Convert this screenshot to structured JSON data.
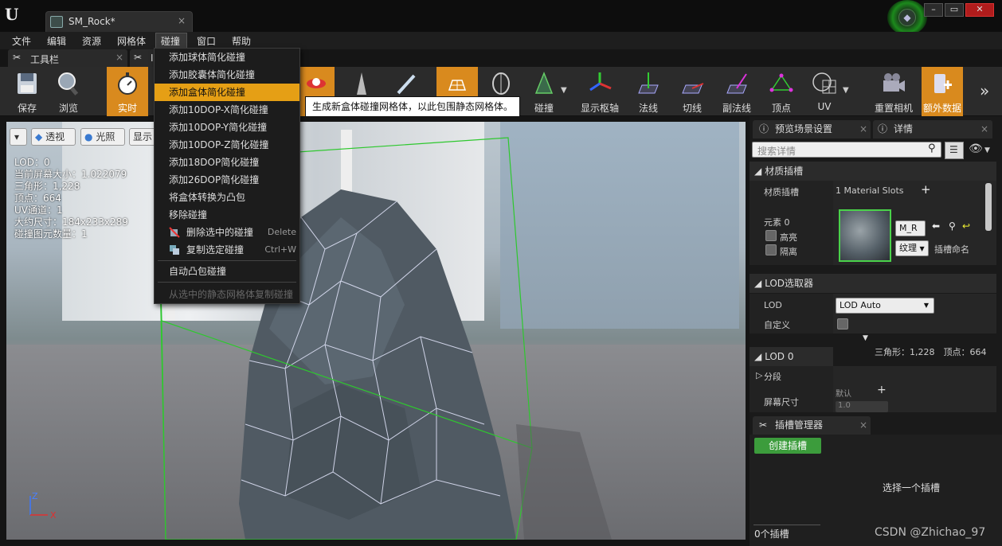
{
  "app": {
    "logo": "U",
    "doc_tab": "SM_Rock*",
    "close_glyph": "×"
  },
  "menus": [
    "文件",
    "编辑",
    "资源",
    "网格体",
    "碰撞",
    "窗口",
    "帮助"
  ],
  "panel_tabs": {
    "toolbar": "工具栏",
    "second": "I"
  },
  "toolbar": {
    "save": "保存",
    "browse": "浏览",
    "realtime": "实时",
    "collision": "碰撞",
    "show_pivot": "显示枢轴",
    "normals": "法线",
    "tangents": "切线",
    "binormals": "副法线",
    "vertices": "顶点",
    "uv": "UV",
    "reset_camera": "重置相机",
    "extra_data": "额外数据"
  },
  "viewport": {
    "perspective": "透视",
    "lit": "光照",
    "show": "显示",
    "stats": [
      "LOD：0",
      "当前屏幕大小：1.022079",
      "三角形：1,228",
      "顶点：664",
      "UV通道：1",
      "大约尺寸：184x233x289",
      "碰撞图元数量：1"
    ],
    "axis_z": "Z",
    "axis_x": "X"
  },
  "collision_menu": {
    "items": [
      {
        "label": "添加球体简化碰撞",
        "shortcut": ""
      },
      {
        "label": "添加胶囊体简化碰撞",
        "shortcut": ""
      },
      {
        "label": "添加盒体简化碰撞",
        "shortcut": ""
      },
      {
        "label": "添加10DOP-X简化碰撞",
        "shortcut": ""
      },
      {
        "label": "添加10DOP-Y简化碰撞",
        "shortcut": ""
      },
      {
        "label": "添加10DOP-Z简化碰撞",
        "shortcut": ""
      },
      {
        "label": "添加18DOP简化碰撞",
        "shortcut": ""
      },
      {
        "label": "添加26DOP简化碰撞",
        "shortcut": ""
      },
      {
        "label": "将盒体转换为凸包",
        "shortcut": ""
      },
      {
        "label": "移除碰撞",
        "shortcut": ""
      },
      {
        "label": "删除选中的碰撞",
        "shortcut": "Delete"
      },
      {
        "label": "复制选定碰撞",
        "shortcut": "Ctrl+W"
      },
      {
        "label": "自动凸包碰撞",
        "shortcut": ""
      },
      {
        "label": "从选中的静态网格体复制碰撞",
        "shortcut": ""
      }
    ],
    "highlight_index": 2,
    "tooltip": "生成新盒体碰撞网格体，以此包围静态网格体。"
  },
  "right_panel": {
    "tab_preview": "预览场景设置",
    "tab_details": "详情",
    "search_placeholder": "搜索详情",
    "material_slots_header": "材质插槽",
    "material_slots_label": "材质插槽",
    "material_slots_value": "1 Material Slots",
    "element_label": "元素 0",
    "highlight": "高亮",
    "isolate": "隔离",
    "material_name": "M_R",
    "texture": "纹理",
    "slot_name": "插槽命名",
    "lod_picker_header": "LOD选取器",
    "lod_label": "LOD",
    "lod_value": "LOD Auto",
    "custom_label": "自定义",
    "lod_stats": "三角形：1,228　顶点：664",
    "lod0_header": "LOD 0",
    "sections": "分段",
    "screen_size": "屏幕尺寸",
    "default_label": "默认",
    "screen_size_value": "1.0"
  },
  "socket_manager": {
    "tab": "插槽管理器",
    "create_button": "创建插槽",
    "select_prompt": "选择一个插槽",
    "count": "0个插槽"
  },
  "watermark": "CSDN @Zhichao_97",
  "colors": {
    "accent_orange": "#d98a1e",
    "menu_highlight": "#e59f15",
    "create_green": "#3c9c3c"
  }
}
